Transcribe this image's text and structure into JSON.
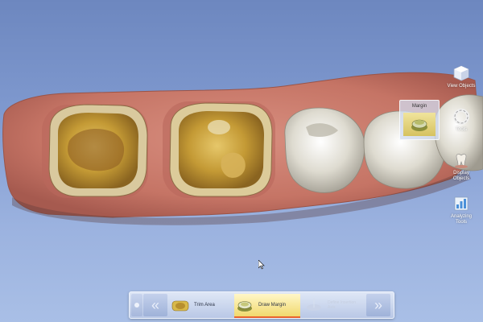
{
  "right_tools": [
    {
      "id": "view-objects",
      "label": "View Objects",
      "icon": "cube-icon"
    },
    {
      "id": "tools",
      "label": "Tools",
      "icon": "ring-icon"
    },
    {
      "id": "display-objects",
      "label": "Display Objects",
      "icon": "tooth-icon"
    },
    {
      "id": "analyzing-tools",
      "label": "Analyzing Tools",
      "icon": "chart-icon"
    }
  ],
  "popup": {
    "title": "Margin",
    "icon": "margin-tool-icon"
  },
  "workflow": {
    "steps": [
      {
        "label": "Trim Area",
        "state": "normal",
        "icon": "trim-area-icon"
      },
      {
        "label": "Draw Margin",
        "state": "active",
        "icon": "draw-margin-icon"
      },
      {
        "label": "Define Insertion Axis",
        "state": "disabled",
        "icon": "insertion-axis-icon"
      }
    ],
    "back_icon": "double-chevron-left-icon",
    "next_icon": "double-chevron-right-icon",
    "active_color": "#f1d96e",
    "active_underline": "#e8622e"
  },
  "colors": {
    "background_top": "#6d87bf",
    "background_bottom": "#a9bfe6",
    "gum": "#c97a6c",
    "prep_tooth": "#c9a23d",
    "natural_tooth": "#e4e2d8"
  }
}
